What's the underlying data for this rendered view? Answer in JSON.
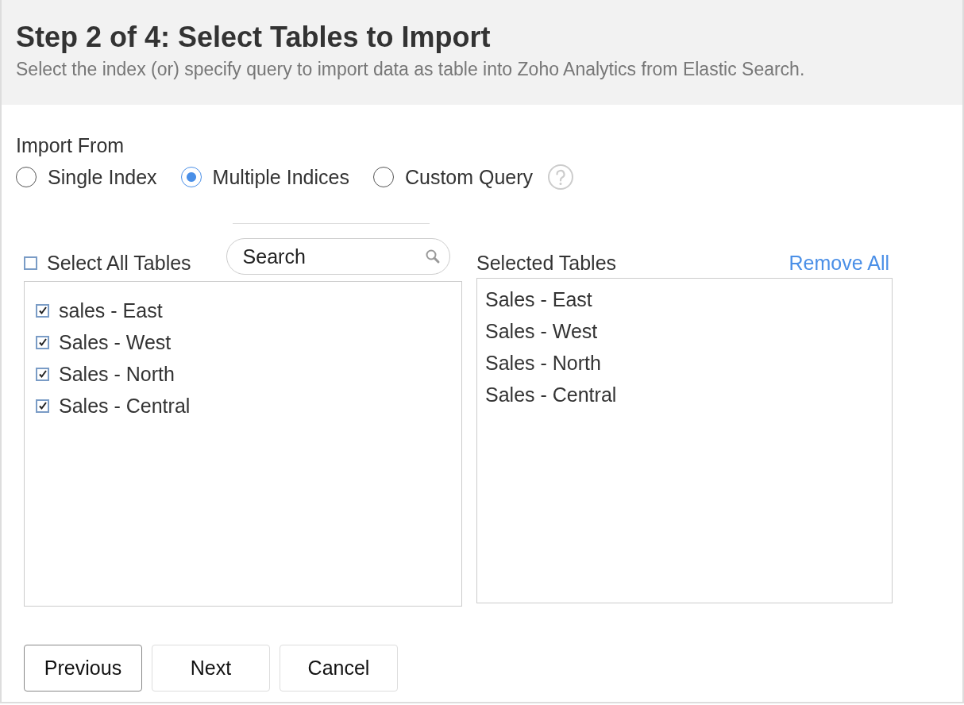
{
  "header": {
    "title": "Step 2 of 4: Select Tables to Import",
    "subtitle": "Select the index (or) specify query to import data as table into Zoho Analytics from Elastic Search."
  },
  "import_from": {
    "label": "Import From",
    "options": [
      {
        "label": "Single Index",
        "selected": false
      },
      {
        "label": "Multiple Indices",
        "selected": true
      },
      {
        "label": "Custom Query",
        "selected": false
      }
    ]
  },
  "available": {
    "select_all": {
      "label": "Select All Tables",
      "checked": false
    },
    "search": {
      "placeholder": "Search"
    },
    "items": [
      {
        "label": "sales - East",
        "checked": true
      },
      {
        "label": "Sales - West",
        "checked": true
      },
      {
        "label": "Sales - North",
        "checked": true
      },
      {
        "label": "Sales - Central",
        "checked": true
      }
    ]
  },
  "selected_tables": {
    "title": "Selected Tables",
    "remove_all": "Remove All",
    "items": [
      "Sales - East",
      "Sales - West",
      "Sales - North",
      "Sales - Central"
    ]
  },
  "buttons": [
    {
      "label": "Previous",
      "focused": true
    },
    {
      "label": "Next",
      "focused": false
    },
    {
      "label": "Cancel",
      "focused": false
    }
  ]
}
